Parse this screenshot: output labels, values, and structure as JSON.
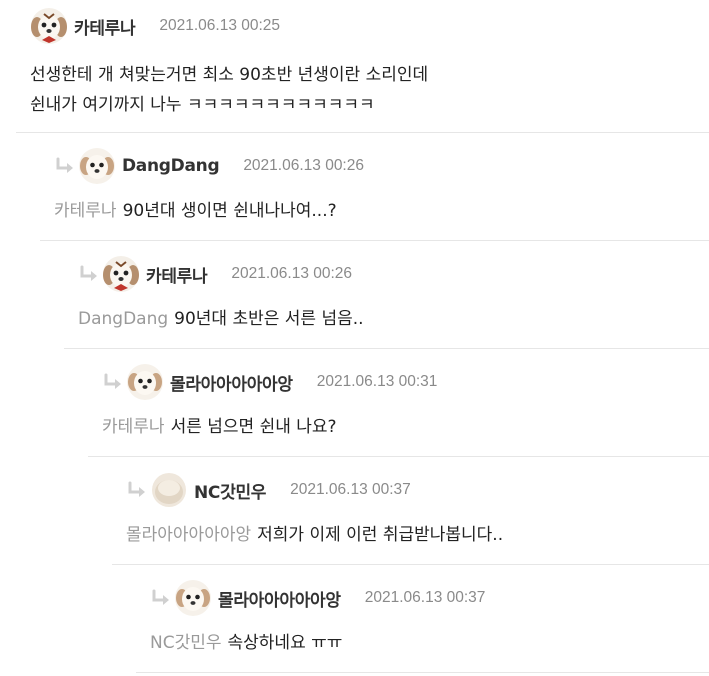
{
  "colors": {
    "nickname": "#333333",
    "date": "#8a8a8a",
    "mention": "#9a9a9a",
    "divider": "#e6e6e6",
    "reply_arrow": "#d0d0d0"
  },
  "comments": [
    {
      "nickname": "카테루나",
      "date": "2021.06.13 00:25",
      "avatar": "puppy-bow-avatar",
      "lines": [
        "선생한테 개 쳐맞는거면 최소 90초반 년생이란 소리인데",
        "쉰내가 여기까지 나누 ㅋㅋㅋㅋㅋㅋㅋㅋㅋㅋㅋㅋ"
      ]
    },
    {
      "nickname": "DangDang",
      "date": "2021.06.13 00:26",
      "avatar": "puppy-avatar",
      "mention": "카테루나",
      "text": "90년대 생이면 쉰내나나여...?"
    },
    {
      "nickname": "카테루나",
      "date": "2021.06.13 00:26",
      "avatar": "puppy-bow-avatar",
      "mention": "DangDang",
      "text": "90년대 초반은 서른 넘음.."
    },
    {
      "nickname": "몰라아아아아아앙",
      "date": "2021.06.13 00:31",
      "avatar": "puppy-avatar",
      "mention": "카테루나",
      "text": "서른 넘으면 쉰내 나요?"
    },
    {
      "nickname": "NC갓민우",
      "date": "2021.06.13 00:37",
      "avatar": "blob-avatar",
      "mention": "몰라아아아아아앙",
      "text": "저희가 이제 이런 취급받나봅니다.."
    },
    {
      "nickname": "몰라아아아아아앙",
      "date": "2021.06.13 00:37",
      "avatar": "puppy-avatar",
      "mention": "NC갓민우",
      "text": "속상하네요 ㅠㅠ"
    }
  ]
}
